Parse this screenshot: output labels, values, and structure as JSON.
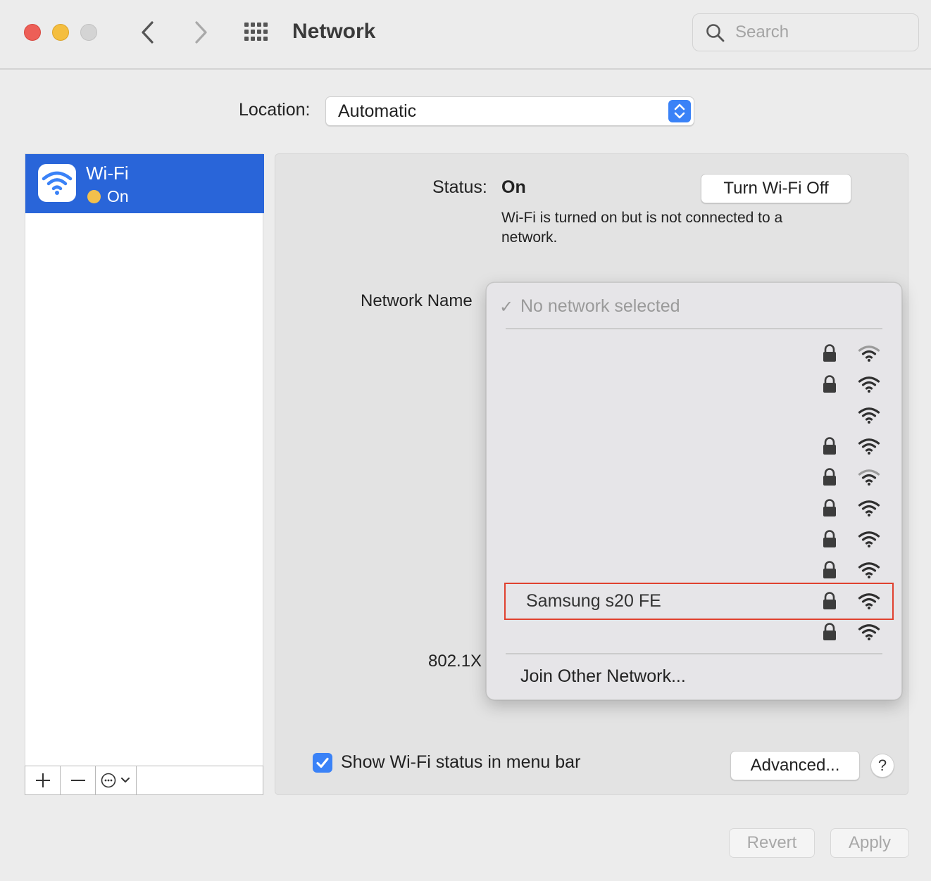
{
  "window": {
    "title": "Network",
    "search_placeholder": "Search"
  },
  "location": {
    "label": "Location:",
    "value": "Automatic"
  },
  "sidebar": {
    "items": [
      {
        "name": "Wi-Fi",
        "status": "On",
        "icon": "wifi-icon",
        "status_color": "#f3c04c"
      }
    ]
  },
  "panel": {
    "status_label": "Status:",
    "status_value": "On",
    "status_description": "Wi-Fi is turned on but is not connected to a network.",
    "turn_off_button": "Turn Wi-Fi Off",
    "network_name_label": "Network Name",
    "dot1x_label": "802.1X",
    "show_status_label": "Show Wi-Fi status in menu bar",
    "show_status_checked": true,
    "advanced_button": "Advanced...",
    "help_button": "?"
  },
  "network_menu": {
    "selected": "No network selected",
    "networks": [
      {
        "name": "",
        "locked": true,
        "signal": "weak"
      },
      {
        "name": "",
        "locked": true,
        "signal": "strong"
      },
      {
        "name": "",
        "locked": false,
        "signal": "strong"
      },
      {
        "name": "",
        "locked": true,
        "signal": "strong"
      },
      {
        "name": "",
        "locked": true,
        "signal": "weak"
      },
      {
        "name": "",
        "locked": true,
        "signal": "strong"
      },
      {
        "name": "",
        "locked": true,
        "signal": "strong"
      },
      {
        "name": "",
        "locked": true,
        "signal": "strong"
      },
      {
        "name": "Samsung s20 FE",
        "locked": true,
        "signal": "strong",
        "highlighted": true
      },
      {
        "name": "",
        "locked": true,
        "signal": "strong"
      }
    ],
    "join_other": "Join Other Network..."
  },
  "footer": {
    "revert_button": "Revert",
    "apply_button": "Apply"
  },
  "colors": {
    "accent": "#3a82f7",
    "sidebar_selected": "#2965d9",
    "highlight_border": "#e0412f"
  }
}
